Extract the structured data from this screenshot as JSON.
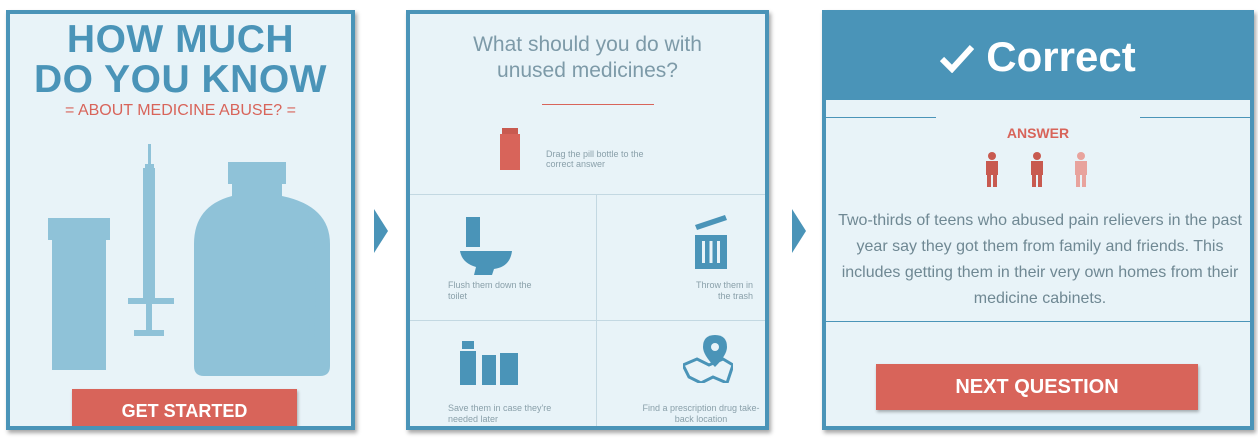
{
  "panel1": {
    "title_line1": "HOW MUCH",
    "title_line2": "DO YOU KNOW",
    "subtitle": "= ABOUT MEDICINE ABUSE? =",
    "button": "GET STARTED"
  },
  "panel2": {
    "question": "What should you do with unused medicines?",
    "drag_hint": "Drag the pill bottle to the correct answer",
    "options": [
      {
        "label": "Flush them down the toilet",
        "icon": "toilet-icon"
      },
      {
        "label": "Throw them in the trash",
        "icon": "trash-can-icon"
      },
      {
        "label": "Save them in case they're needed later",
        "icon": "pill-bottles-icon"
      },
      {
        "label": "Find a prescription drug take-back location",
        "icon": "map-location-icon"
      }
    ]
  },
  "panel3": {
    "result": "Correct",
    "answer_label": "ANSWER",
    "answer_text": "Two-thirds of teens who abused pain relievers in the past year say they got them from family and friends. This includes getting them in their very own homes from their medicine cabinets.",
    "ratio_highlighted": 2,
    "ratio_total": 3,
    "button": "NEXT QUESTION"
  },
  "colors": {
    "primary": "#4a94b8",
    "accent": "#d8645a",
    "panel_bg": "#e8f3f8",
    "icon_light": "#8fc2d8"
  }
}
